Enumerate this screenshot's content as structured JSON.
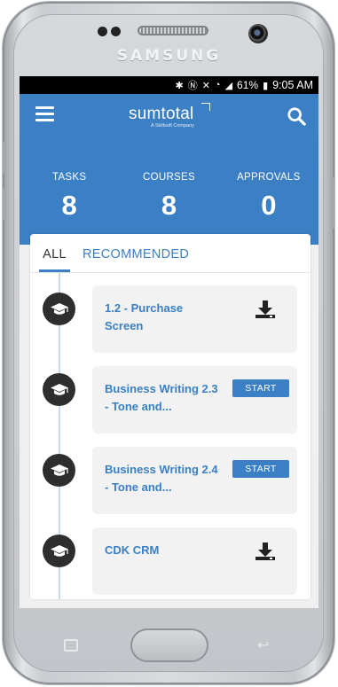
{
  "device": {
    "brand": "SAMSUNG"
  },
  "status_bar": {
    "battery": "61%",
    "time": "9:05 AM"
  },
  "header": {
    "logo_name": "sumtotal",
    "logo_sub": "A Skillsoft Company",
    "stats": [
      {
        "label": "TASKS",
        "value": "8"
      },
      {
        "label": "COURSES",
        "value": "8"
      },
      {
        "label": "APPROVALS",
        "value": "0"
      }
    ]
  },
  "tabs": [
    {
      "label": "ALL",
      "active": true
    },
    {
      "label": "RECOMMENDED",
      "active": false
    }
  ],
  "items": [
    {
      "title": "1.2 - Purchase Screen",
      "action": "download"
    },
    {
      "title": "Business Writing 2.3 - Tone and...",
      "action": "start",
      "action_label": "START"
    },
    {
      "title": "Business Writing 2.4 - Tone and...",
      "action": "start",
      "action_label": "START"
    },
    {
      "title": "CDK CRM",
      "action": "download"
    }
  ],
  "colors": {
    "brand_blue": "#3b7fc4",
    "timeline": "#c8daef",
    "item_bg": "#f2f2f2"
  },
  "icons": {
    "menu": "hamburger-menu-icon",
    "search": "search-icon",
    "course": "graduation-cap-icon",
    "download": "download-icon"
  }
}
